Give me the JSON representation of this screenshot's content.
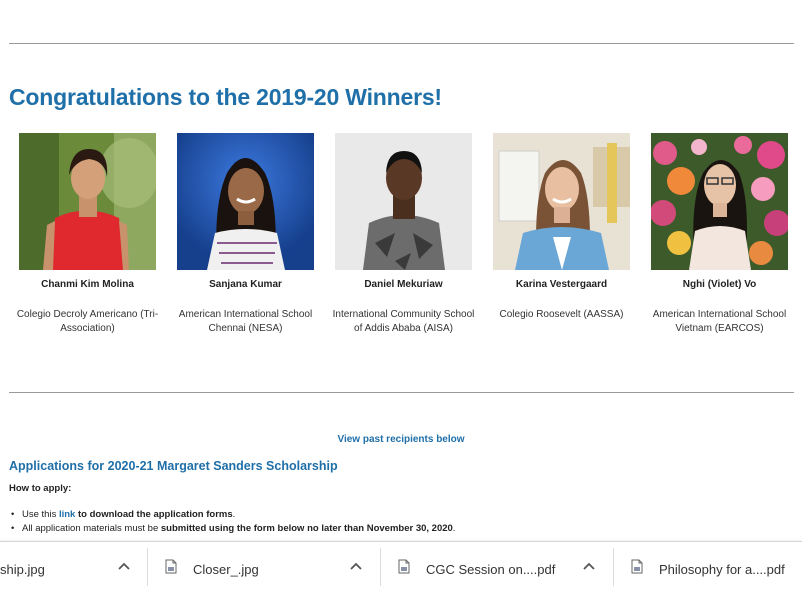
{
  "heading": "Congratulations to the 2019-20 Winners!",
  "winners": [
    {
      "name": "Chanmi Kim Molina",
      "school": "Colegio Decroly Americano (Tri-Association)"
    },
    {
      "name": "Sanjana Kumar",
      "school": "American International School Chennai (NESA)"
    },
    {
      "name": "Daniel Mekuriaw",
      "school": "International Community School of Addis Ababa (AISA)"
    },
    {
      "name": "Karina Vestergaard",
      "school": "Colegio Roosevelt (AASSA)"
    },
    {
      "name": "Nghi (Violet) Vo",
      "school": "American International School Vietnam (EARCOS)"
    }
  ],
  "past_link": "View past recipients below",
  "applications_title": "Applications for 2020-21 Margaret Sanders Scholarship",
  "how_to_apply": "How to apply:",
  "bullets": {
    "b1_pre": "Use this ",
    "b1_link": "link",
    "b1_bold": " to download the application forms",
    "b1_end": ".",
    "b2_pre": "All application materials must be ",
    "b2_bold": "submitted using the form below no later than November 30, 2020",
    "b2_end": "."
  },
  "downloads": [
    {
      "name": "ship.jpg",
      "icon": "file-icon"
    },
    {
      "name": "Closer_.jpg",
      "icon": "file-icon"
    },
    {
      "name": "CGC Session on....pdf",
      "icon": "file-icon"
    },
    {
      "name": "Philosophy for a....pdf",
      "icon": "file-icon"
    }
  ]
}
